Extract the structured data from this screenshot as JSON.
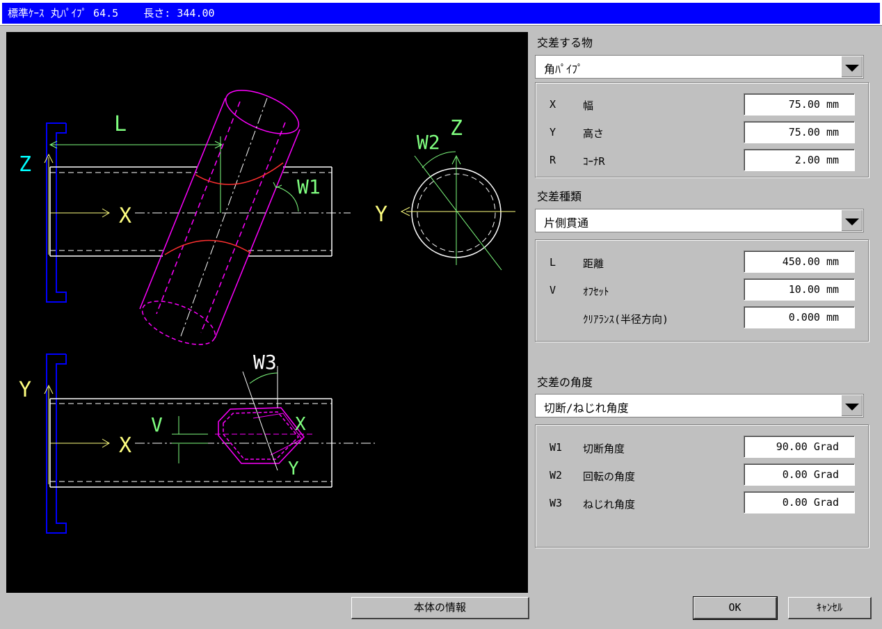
{
  "window": {
    "title": "標準ｹｰｽ 丸ﾊﾟｲﾌﾟ 64.5    長さ: 344.00"
  },
  "viewport": {
    "labels": {
      "L": "L",
      "Z": "Z",
      "X": "X",
      "Y": "Y",
      "W1": "W1",
      "W2": "W2",
      "W3": "W3",
      "V": "V"
    },
    "colors": {
      "background": "#000000",
      "pipe": "#ff00ff",
      "frame": "#0000ff",
      "dim": "#00ff00",
      "axis": "#ffff80",
      "arc": "#ff0000"
    }
  },
  "intersect_object": {
    "label": "交差する物",
    "selected": "角ﾊﾟｲﾌﾟ",
    "rows": [
      {
        "key": "X",
        "label": "幅",
        "value": "75.00",
        "unit": "mm"
      },
      {
        "key": "Y",
        "label": "高さ",
        "value": "75.00",
        "unit": "mm"
      },
      {
        "key": "R",
        "label": "ｺｰﾅR",
        "value": "2.00",
        "unit": "mm"
      }
    ]
  },
  "intersect_type": {
    "label": "交差種類",
    "selected": "片側貫通",
    "rows": [
      {
        "key": "L",
        "label": "距離",
        "value": "450.00",
        "unit": "mm"
      },
      {
        "key": "V",
        "label": "ｵﾌｾｯﾄ",
        "value": "10.00",
        "unit": "mm"
      },
      {
        "key": "",
        "label": "ｸﾘｱﾗﾝｽ(半径方向)",
        "value": "0.000",
        "unit": "mm"
      }
    ]
  },
  "intersect_angle": {
    "label": "交差の角度",
    "selected": "切断/ねじれ角度",
    "rows": [
      {
        "key": "W1",
        "label": "切断角度",
        "value": "90.00",
        "unit": "Grad"
      },
      {
        "key": "W2",
        "label": "回転の角度",
        "value": "0.00",
        "unit": "Grad"
      },
      {
        "key": "W3",
        "label": "ねじれ角度",
        "value": "0.00",
        "unit": "Grad"
      }
    ]
  },
  "buttons": {
    "body_info": "本体の情報",
    "ok": "OK",
    "cancel": "ｷｬﾝｾﾙ"
  },
  "icons": {
    "combo_arrow": "chevron-down-icon"
  }
}
